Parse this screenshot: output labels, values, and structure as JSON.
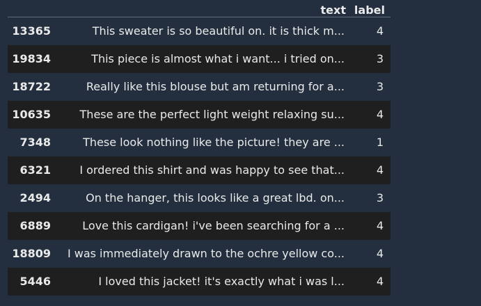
{
  "table": {
    "columns": [
      "text",
      "label"
    ],
    "rows": [
      {
        "index": "13365",
        "text": "This sweater is so beautiful on. it is thick m...",
        "label": "4"
      },
      {
        "index": "19834",
        "text": "This piece is almost what i want... i tried on...",
        "label": "3"
      },
      {
        "index": "18722",
        "text": "Really like this blouse but am returning for a...",
        "label": "3"
      },
      {
        "index": "10635",
        "text": "These are the perfect light weight relaxing su...",
        "label": "4"
      },
      {
        "index": "7348",
        "text": "These look nothing like the picture! they are ...",
        "label": "1"
      },
      {
        "index": "6321",
        "text": "I ordered this shirt and was happy to see that...",
        "label": "4"
      },
      {
        "index": "2494",
        "text": "On the hanger, this looks like a great lbd. on...",
        "label": "3"
      },
      {
        "index": "6889",
        "text": "Love this cardigan! i've been searching for a ...",
        "label": "4"
      },
      {
        "index": "18809",
        "text": "I was immediately drawn to the ochre yellow co...",
        "label": "4"
      },
      {
        "index": "5446",
        "text": "I loved this jacket! it's exactly what i was l...",
        "label": "4"
      }
    ]
  }
}
